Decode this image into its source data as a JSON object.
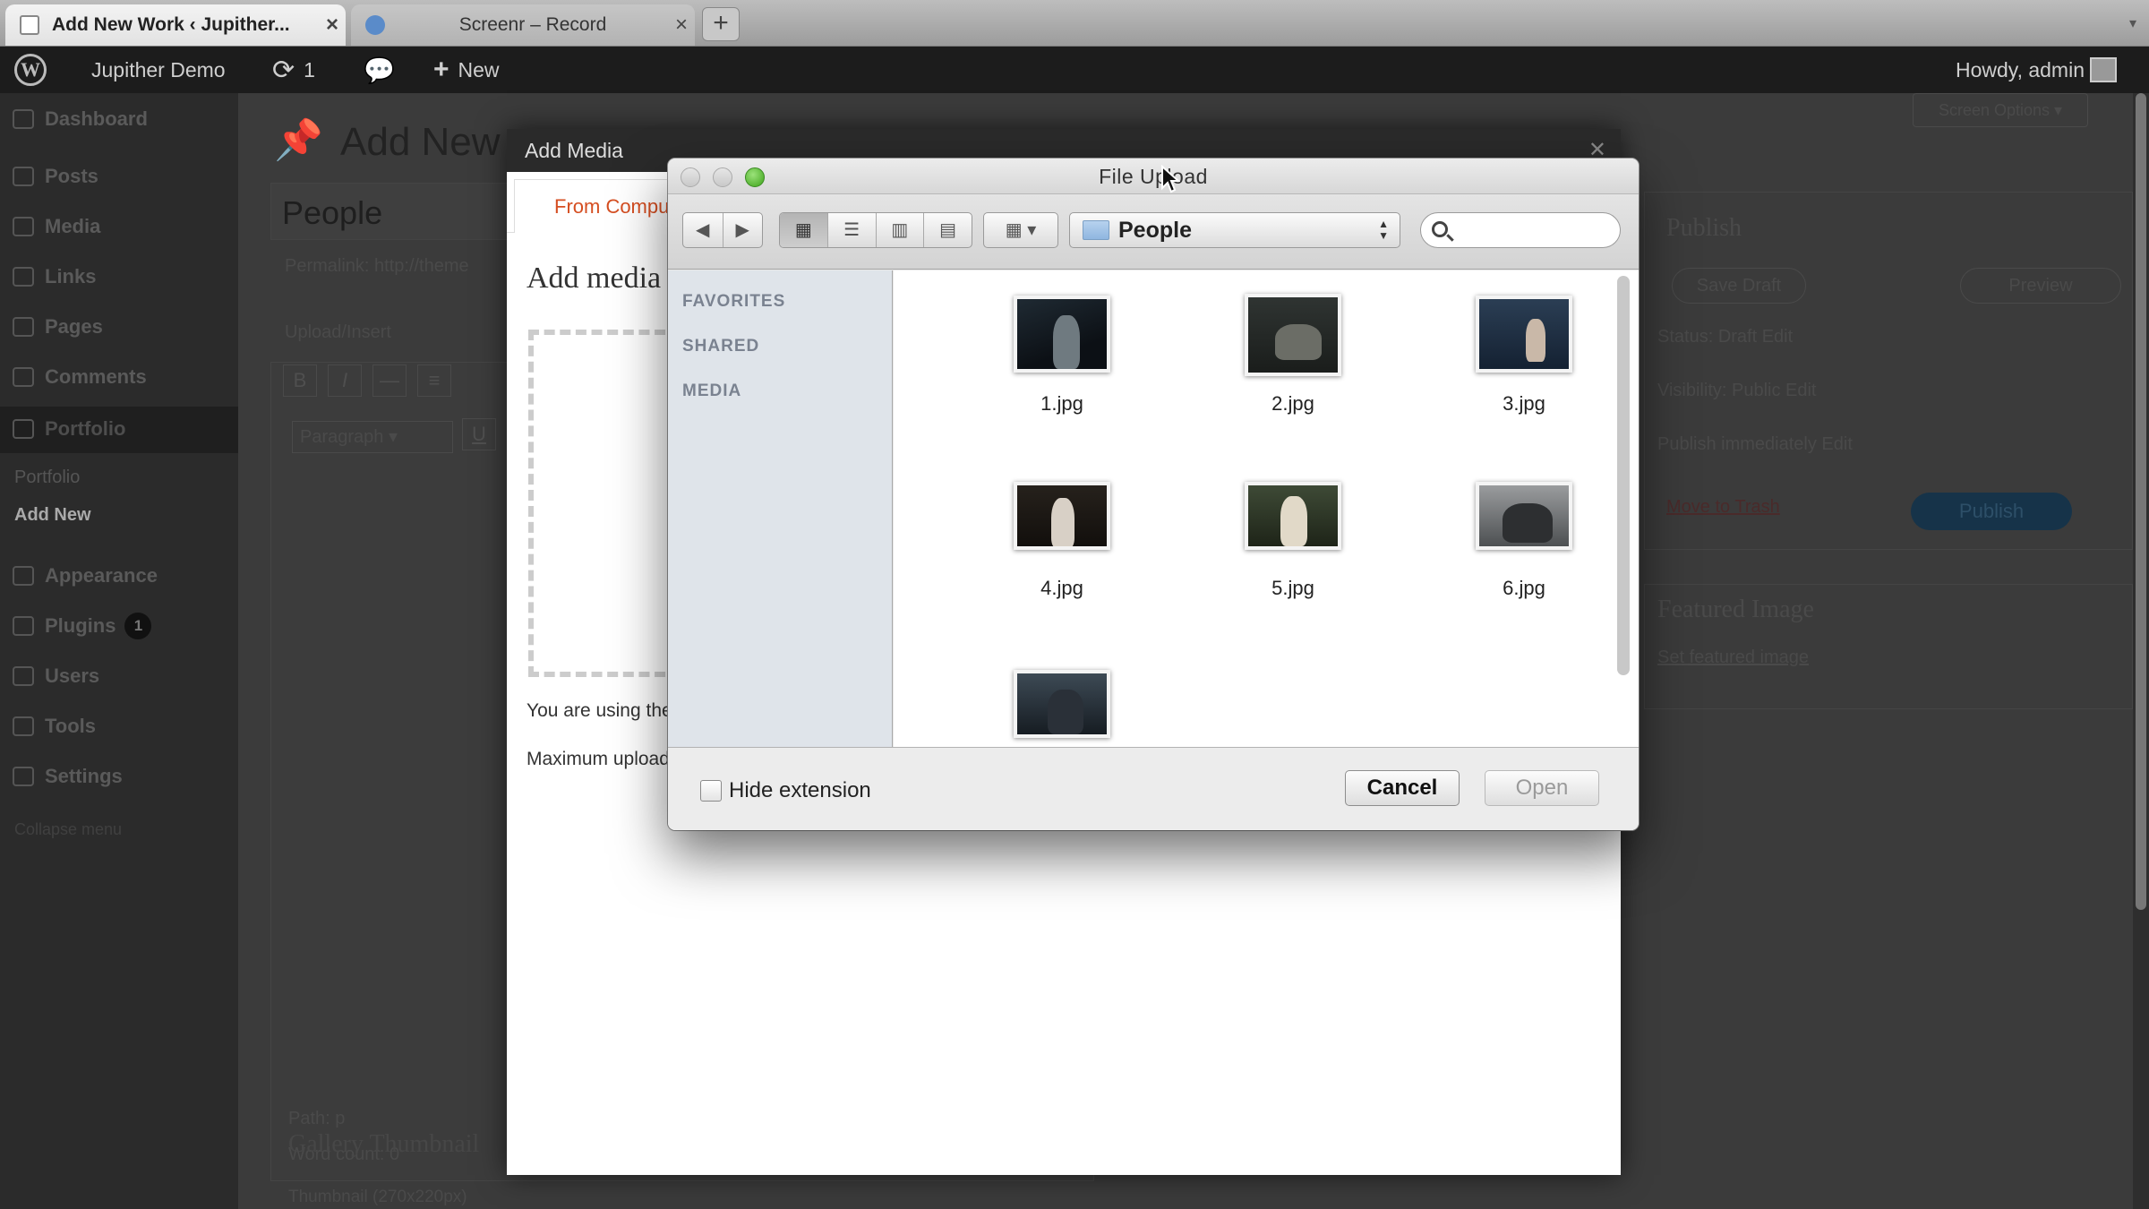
{
  "browser": {
    "tabs": [
      {
        "title": "Add New Work ‹ Jupither...",
        "active": true
      },
      {
        "title": "Screenr – Record",
        "active": false
      }
    ],
    "new_tab_label": "+"
  },
  "adminbar": {
    "site_name": "Jupither Demo",
    "updates_count": "1",
    "new_label": "New",
    "howdy": "Howdy, admin"
  },
  "sidebar": {
    "items": [
      {
        "label": "Dashboard"
      },
      {
        "label": "Posts"
      },
      {
        "label": "Media"
      },
      {
        "label": "Links"
      },
      {
        "label": "Pages"
      },
      {
        "label": "Comments"
      },
      {
        "label": "Portfolio"
      },
      {
        "label": "Appearance"
      },
      {
        "label": "Plugins",
        "badge": "1"
      },
      {
        "label": "Users"
      },
      {
        "label": "Tools"
      },
      {
        "label": "Settings"
      }
    ],
    "submenu": [
      {
        "label": "Portfolio"
      },
      {
        "label": "Add New"
      }
    ],
    "collapse_label": "Collapse menu"
  },
  "page": {
    "title": "Add New",
    "post_title_value": "People",
    "permalink": "Permalink: http://theme",
    "upload_insert": "Upload/Insert",
    "paragraph_select": "Paragraph",
    "path": "Path: p",
    "word_count": "Word count: 0",
    "gallery_title": "Gallery Thumbnail",
    "thumbnail_note": "Thumbnail (270x220px)",
    "screen_options": "Screen Options ▾"
  },
  "publish_box": {
    "heading": "Publish",
    "save_draft": "Save Draft",
    "preview": "Preview",
    "status": "Status: Draft Edit",
    "visibility": "Visibility: Public Edit",
    "publish_when": "Publish immediately Edit",
    "trash": "Move to Trash",
    "publish": "Publish"
  },
  "featured_box": {
    "heading": "Featured Image",
    "link": "Set featured image"
  },
  "add_media": {
    "header": "Add Media",
    "tab": "From Computer",
    "heading": "Add media",
    "using_text": "You are using the",
    "max_upload": "Maximum upload"
  },
  "file_upload": {
    "title": "File Upload",
    "location": "People",
    "search_placeholder": "",
    "sidebar_sections": [
      "FAVORITES",
      "SHARED",
      "MEDIA"
    ],
    "files": [
      "1.jpg",
      "2.jpg",
      "3.jpg",
      "4.jpg",
      "5.jpg",
      "6.jpg",
      ""
    ],
    "hide_extension_label": "Hide extension",
    "hide_extension_checked": false,
    "cancel_label": "Cancel",
    "open_label": "Open",
    "open_enabled": false
  }
}
